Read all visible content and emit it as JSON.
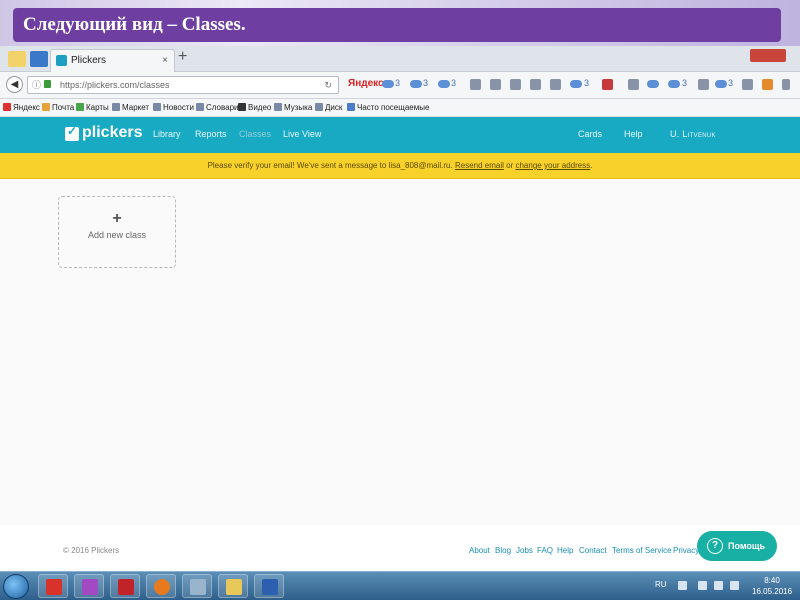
{
  "slide": {
    "title": "Следующий вид – Classes."
  },
  "browser": {
    "tab_title": "Plickers",
    "tab_close": "×",
    "new_tab": "+",
    "url": "https://plickers.com/classes",
    "search_label": "Яндекс",
    "toolbar_counts": [
      "3",
      "3",
      "3",
      "3",
      "3",
      "3"
    ],
    "bookmarks": [
      "Яндекс",
      "Почта",
      "Карты",
      "Маркет",
      "Новости",
      "Словари",
      "Видео",
      "Музыка",
      "Диск",
      "Часто посещаемые"
    ]
  },
  "app": {
    "logo": "plickers",
    "nav": {
      "library": "Library",
      "reports": "Reports",
      "classes": "Classes",
      "live_view": "Live View"
    },
    "right_nav": {
      "cards": "Cards",
      "help": "Help",
      "user": "U. Litvenuk"
    },
    "banner": {
      "text_before": "Please verify your email! We've sent a message to lisa_808@mail.ru.",
      "resend_link": "Resend email",
      "or": "or",
      "change_link": "change your address",
      "end": "."
    },
    "add_class": {
      "plus": "+",
      "label": "Add new class"
    },
    "footer": {
      "copyright": "© 2016 Plickers",
      "links": [
        "About",
        "Blog",
        "Jobs",
        "FAQ",
        "Help",
        "Contact",
        "Terms of Service",
        "Privacy"
      ]
    },
    "help_button": {
      "icon": "?",
      "label": "Помощь"
    }
  },
  "taskbar": {
    "lang": "RU",
    "time": "8:40",
    "date": "16.05.2016"
  },
  "colors": {
    "slide_title_bg": "#6e3fa0",
    "app_bar": "#18aac3",
    "banner": "#f8d22b",
    "help_button": "#18b0a4"
  }
}
